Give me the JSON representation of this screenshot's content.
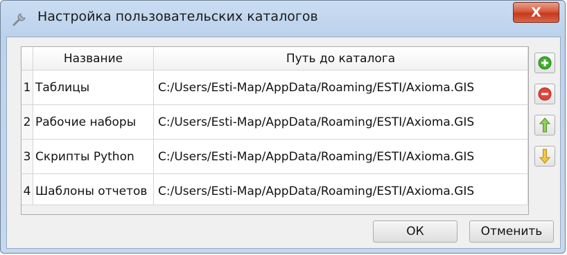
{
  "window": {
    "title": "Настройка пользовательских каталогов",
    "close_label": "X"
  },
  "table": {
    "columns": [
      "",
      "Название",
      "Путь до каталога"
    ],
    "rows": [
      {
        "num": "1",
        "name": "Таблицы",
        "path": "C:/Users/Esti-Map/AppData/Roaming/ESTI/Axioma.GIS"
      },
      {
        "num": "2",
        "name": "Рабочие наборы",
        "path": "C:/Users/Esti-Map/AppData/Roaming/ESTI/Axioma.GIS"
      },
      {
        "num": "3",
        "name": "Скрипты Python",
        "path": "C:/Users/Esti-Map/AppData/Roaming/ESTI/Axioma.GIS"
      },
      {
        "num": "4",
        "name": "Шаблоны отчетов",
        "path": "C:/Users/Esti-Map/AppData/Roaming/ESTI/Axioma.GIS"
      }
    ]
  },
  "side_buttons": [
    "add-icon",
    "remove-icon",
    "arrow-up-icon",
    "arrow-down-icon"
  ],
  "footer": {
    "ok_label": "ОК",
    "cancel_label": "Отменить"
  },
  "colors": {
    "add": "#3fae2a",
    "remove": "#e0453a",
    "arrow": "#5aa52f",
    "close": "#c7391b"
  }
}
